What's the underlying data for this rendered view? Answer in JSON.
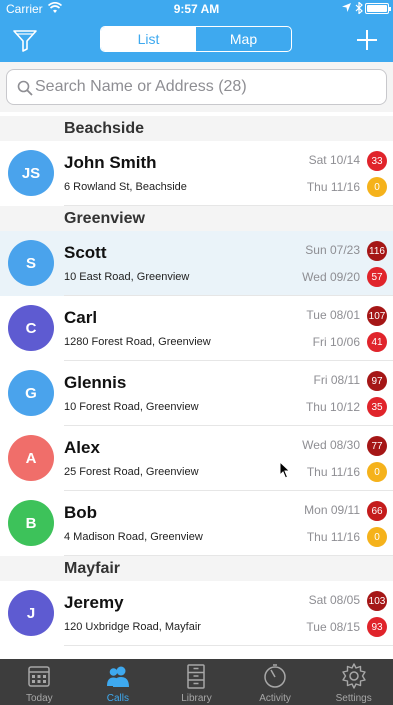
{
  "status_bar": {
    "carrier": "Carrier",
    "time": "9:57 AM"
  },
  "nav": {
    "segments": [
      {
        "label": "List",
        "active": true
      },
      {
        "label": "Map",
        "active": false
      }
    ],
    "filter_icon": "filter-icon",
    "add_icon": "plus-icon"
  },
  "search": {
    "placeholder": "Search Name or Address (28)",
    "value": ""
  },
  "sections": [
    {
      "title": "Beachside",
      "rows": [
        {
          "initials": "JS",
          "name": "John Smith",
          "address": "6 Rowland St, Beachside",
          "date1": "Sat 10/14",
          "badge1": "33",
          "badge1_color": "#e0242b",
          "date2": "Thu 11/16",
          "badge2": "0",
          "badge2_color": "#f5b21b",
          "avatar_color": "#4aa3ec"
        }
      ]
    },
    {
      "title": "Greenview",
      "rows": [
        {
          "initials": "S",
          "name": "Scott",
          "address": "10 East Road, Greenview",
          "date1": "Sun 07/23",
          "badge1": "116",
          "badge1_color": "#a51616",
          "date2": "Wed 09/20",
          "badge2": "57",
          "badge2_color": "#e0242b",
          "avatar_color": "#4aa3ec",
          "selected": true
        },
        {
          "initials": "C",
          "name": "Carl",
          "address": "1280 Forest Road, Greenview",
          "date1": "Tue 08/01",
          "badge1": "107",
          "badge1_color": "#a51616",
          "date2": "Fri 10/06",
          "badge2": "41",
          "badge2_color": "#e0242b",
          "avatar_color": "#5e5bd1"
        },
        {
          "initials": "G",
          "name": "Glennis",
          "address": "10 Forest Road, Greenview",
          "date1": "Fri 08/11",
          "badge1": "97",
          "badge1_color": "#a51616",
          "date2": "Thu 10/12",
          "badge2": "35",
          "badge2_color": "#e0242b",
          "avatar_color": "#4aa3ec"
        },
        {
          "initials": "A",
          "name": "Alex",
          "address": "25 Forest Road, Greenview",
          "date1": "Wed 08/30",
          "badge1": "77",
          "badge1_color": "#a51616",
          "date2": "Thu 11/16",
          "badge2": "0",
          "badge2_color": "#f5b21b",
          "avatar_color": "#f06e6a"
        },
        {
          "initials": "B",
          "name": "Bob",
          "address": "4 Madison Road, Greenview",
          "date1": "Mon 09/11",
          "badge1": "66",
          "badge1_color": "#c41b1b",
          "date2": "Thu 11/16",
          "badge2": "0",
          "badge2_color": "#f5b21b",
          "avatar_color": "#3dc25a"
        }
      ]
    },
    {
      "title": "Mayfair",
      "rows": [
        {
          "initials": "J",
          "name": "Jeremy",
          "address": "120 Uxbridge Road, Mayfair",
          "date1": "Sat 08/05",
          "badge1": "103",
          "badge1_color": "#a51616",
          "date2": "Tue 08/15",
          "badge2": "93",
          "badge2_color": "#e0242b",
          "avatar_color": "#5e5bd1"
        }
      ]
    }
  ],
  "tabbar": [
    {
      "label": "Today",
      "icon": "calendar-icon",
      "active": false
    },
    {
      "label": "Calls",
      "icon": "people-icon",
      "active": true
    },
    {
      "label": "Library",
      "icon": "cabinet-icon",
      "active": false
    },
    {
      "label": "Activity",
      "icon": "stopwatch-icon",
      "active": false
    },
    {
      "label": "Settings",
      "icon": "gear-icon",
      "active": false
    }
  ],
  "colors": {
    "accent": "#3ea9ef",
    "tabbar_bg": "#3d3d3d",
    "section_bg": "#f4f4f4",
    "selected_row": "#eaf3f9"
  }
}
